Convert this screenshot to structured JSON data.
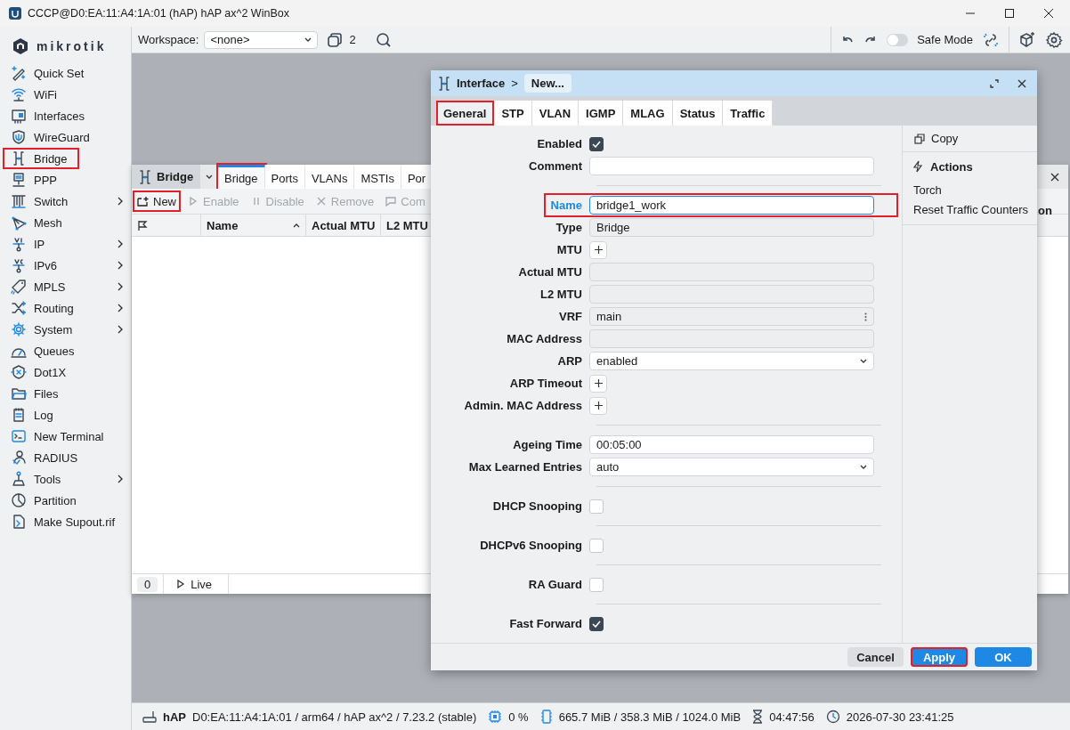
{
  "window": {
    "title": "CCCP@D0:EA:11:A4:1A:01 (hAP) hAP ax^2 WinBox"
  },
  "sidebar": {
    "logo": "mikrotik",
    "items": [
      {
        "label": "Quick Set",
        "submenu": false,
        "highlighted": false
      },
      {
        "label": "WiFi",
        "submenu": false,
        "highlighted": false
      },
      {
        "label": "Interfaces",
        "submenu": false,
        "highlighted": false
      },
      {
        "label": "WireGuard",
        "submenu": false,
        "highlighted": false
      },
      {
        "label": "Bridge",
        "submenu": false,
        "highlighted": true
      },
      {
        "label": "PPP",
        "submenu": false,
        "highlighted": false
      },
      {
        "label": "Switch",
        "submenu": true,
        "highlighted": false
      },
      {
        "label": "Mesh",
        "submenu": false,
        "highlighted": false
      },
      {
        "label": "IP",
        "submenu": true,
        "highlighted": false
      },
      {
        "label": "IPv6",
        "submenu": true,
        "highlighted": false
      },
      {
        "label": "MPLS",
        "submenu": true,
        "highlighted": false
      },
      {
        "label": "Routing",
        "submenu": true,
        "highlighted": false
      },
      {
        "label": "System",
        "submenu": true,
        "highlighted": false
      },
      {
        "label": "Queues",
        "submenu": false,
        "highlighted": false
      },
      {
        "label": "Dot1X",
        "submenu": false,
        "highlighted": false
      },
      {
        "label": "Files",
        "submenu": false,
        "highlighted": false
      },
      {
        "label": "Log",
        "submenu": false,
        "highlighted": false
      },
      {
        "label": "New Terminal",
        "submenu": false,
        "highlighted": false
      },
      {
        "label": "RADIUS",
        "submenu": false,
        "highlighted": false
      },
      {
        "label": "Tools",
        "submenu": true,
        "highlighted": false
      },
      {
        "label": "Partition",
        "submenu": false,
        "highlighted": false
      },
      {
        "label": "Make Supout.rif",
        "submenu": false,
        "highlighted": false
      }
    ]
  },
  "toolbar": {
    "workspace_label": "Workspace:",
    "workspace_value": "<none>",
    "window_count": "2",
    "safe_mode_label": "Safe Mode",
    "safe_mode_on": false
  },
  "bridge_window": {
    "title": "Bridge",
    "tabs": [
      {
        "label": "Bridge",
        "selected": true,
        "highlighted": true
      },
      {
        "label": "Ports",
        "selected": false,
        "highlighted": false
      },
      {
        "label": "VLANs",
        "selected": false,
        "highlighted": false
      },
      {
        "label": "MSTIs",
        "selected": false,
        "highlighted": false
      },
      {
        "label": "Por",
        "selected": false,
        "highlighted": false
      }
    ],
    "actions": [
      {
        "label": "New",
        "disabled": false,
        "highlighted": true
      },
      {
        "label": "Enable",
        "disabled": true,
        "highlighted": false
      },
      {
        "label": "Disable",
        "disabled": true,
        "highlighted": false
      },
      {
        "label": "Remove",
        "disabled": true,
        "highlighted": false
      },
      {
        "label": "Com",
        "disabled": true,
        "highlighted": false
      }
    ],
    "columns": [
      {
        "label": "Name",
        "sorted": true
      },
      {
        "label": "Actual MTU"
      },
      {
        "label": "L2 MTU"
      }
    ],
    "cut_label": "on",
    "count": "0",
    "live_label": "Live"
  },
  "dialog": {
    "breadcrumb": "Interface",
    "separator": ">",
    "crumb": "New...",
    "tabs": [
      {
        "label": "General",
        "selected": true,
        "highlighted": true
      },
      {
        "label": "STP",
        "selected": false,
        "highlighted": false
      },
      {
        "label": "VLAN",
        "selected": false,
        "highlighted": false
      },
      {
        "label": "IGMP",
        "selected": false,
        "highlighted": false
      },
      {
        "label": "MLAG",
        "selected": false,
        "highlighted": false
      },
      {
        "label": "Status",
        "selected": false,
        "highlighted": false
      },
      {
        "label": "Traffic",
        "selected": false,
        "highlighted": false
      }
    ],
    "fields": [
      {
        "kind": "checkbox",
        "label": "Enabled",
        "checked": true
      },
      {
        "kind": "text",
        "label": "Comment"
      },
      {
        "kind": "divider"
      },
      {
        "kind": "text",
        "label": "Name",
        "value": "bridge1_work",
        "focused": true,
        "highlighted": true
      },
      {
        "kind": "readonly",
        "label": "Type",
        "value": "Bridge"
      },
      {
        "kind": "plus",
        "label": "MTU"
      },
      {
        "kind": "readonly",
        "label": "Actual MTU"
      },
      {
        "kind": "readonly",
        "label": "L2 MTU"
      },
      {
        "kind": "menu",
        "label": "VRF",
        "value": "main"
      },
      {
        "kind": "readonly",
        "label": "MAC Address"
      },
      {
        "kind": "select",
        "label": "ARP",
        "value": "enabled"
      },
      {
        "kind": "plus",
        "label": "ARP Timeout"
      },
      {
        "kind": "plus",
        "label": "Admin. MAC Address"
      },
      {
        "kind": "divider"
      },
      {
        "kind": "text",
        "label": "Ageing Time",
        "value": "00:05:00"
      },
      {
        "kind": "select",
        "label": "Max Learned Entries",
        "value": "auto"
      },
      {
        "kind": "divider"
      },
      {
        "kind": "checkbox",
        "label": "DHCP Snooping",
        "checked": false
      },
      {
        "kind": "divider"
      },
      {
        "kind": "checkbox",
        "label": "DHCPv6 Snooping",
        "checked": false
      },
      {
        "kind": "divider"
      },
      {
        "kind": "checkbox",
        "label": "RA Guard",
        "checked": false
      },
      {
        "kind": "divider"
      },
      {
        "kind": "checkbox",
        "label": "Fast Forward",
        "checked": true
      }
    ],
    "side": {
      "copy_label": "Copy",
      "actions_title": "Actions",
      "actions": [
        "Torch",
        "Reset Traffic Counters"
      ]
    },
    "buttons": [
      {
        "label": "Cancel",
        "kind": "default",
        "highlighted": false
      },
      {
        "label": "Apply",
        "kind": "primary",
        "highlighted": true
      },
      {
        "label": "OK",
        "kind": "primary",
        "highlighted": false
      }
    ]
  },
  "status_bar": {
    "device": "hAP",
    "info": "D0:EA:11:A4:1A:01 / arm64 / hAP ax^2 / 7.23.2 (stable)",
    "cpu": "0 %",
    "memory": "665.7 MiB / 358.3 MiB / 1024.0 MiB",
    "uptime": "04:47:56",
    "clock": "2026-07-30 23:41:25"
  }
}
